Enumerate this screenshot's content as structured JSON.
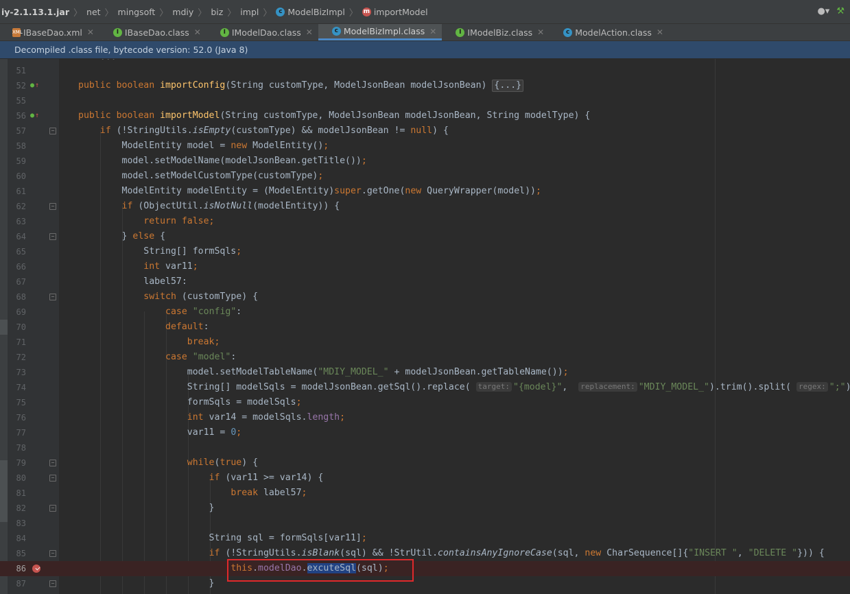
{
  "breadcrumb": {
    "jar": "iy-2.1.13.1.jar",
    "segments": [
      "net",
      "mingsoft",
      "mdiy",
      "biz",
      "impl"
    ],
    "class_name": "ModelBizImpl",
    "method_name": "importModel"
  },
  "tabs": [
    {
      "icon": "xml-file-icon",
      "label": "IBaseDao.xml"
    },
    {
      "icon": "interface-icon",
      "label": "IBaseDao.class"
    },
    {
      "icon": "interface-icon",
      "label": "IModelDao.class"
    },
    {
      "icon": "class-icon",
      "label": "ModelBizImpl.class",
      "active": true
    },
    {
      "icon": "interface-icon",
      "label": "IModelBiz.class"
    },
    {
      "icon": "class-icon",
      "label": "ModelAction.class"
    }
  ],
  "banner": "Decompiled .class file, bytecode version: 52.0 (Java 8)",
  "line_numbers": [
    "51",
    "52",
    "55",
    "56",
    "57",
    "58",
    "59",
    "60",
    "61",
    "62",
    "63",
    "64",
    "65",
    "66",
    "67",
    "68",
    "69",
    "70",
    "71",
    "72",
    "73",
    "74",
    "75",
    "76",
    "77",
    "78",
    "79",
    "80",
    "81",
    "82",
    "83",
    "84",
    "85",
    "86",
    "87"
  ],
  "hints": {
    "target": "target:",
    "replacement": "replacement:",
    "regex": "regex:"
  },
  "folded_body": "{...}",
  "code": {
    "l52": "public boolean importConfig(String customType, ModelJsonBean modelJsonBean)",
    "l56": "public boolean importModel(String customType, ModelJsonBean modelJsonBean, String modelType) {",
    "l73_str": "\"MDIY_MODEL_\"",
    "l74_a": "\"{model}\"",
    "l74_b": "\"MDIY_MODEL_\"",
    "l74_c": "\";\"",
    "l85_a": "\"INSERT \"",
    "l85_b": "\"DELETE \"",
    "l86": "this.modelDao.excuteSql(sql);"
  },
  "colors": {
    "keyword": "#cc7832",
    "method": "#ffc66d",
    "string": "#6a8759",
    "number": "#6897bb",
    "field": "#9876aa",
    "highlight_box": "#e0292b"
  }
}
